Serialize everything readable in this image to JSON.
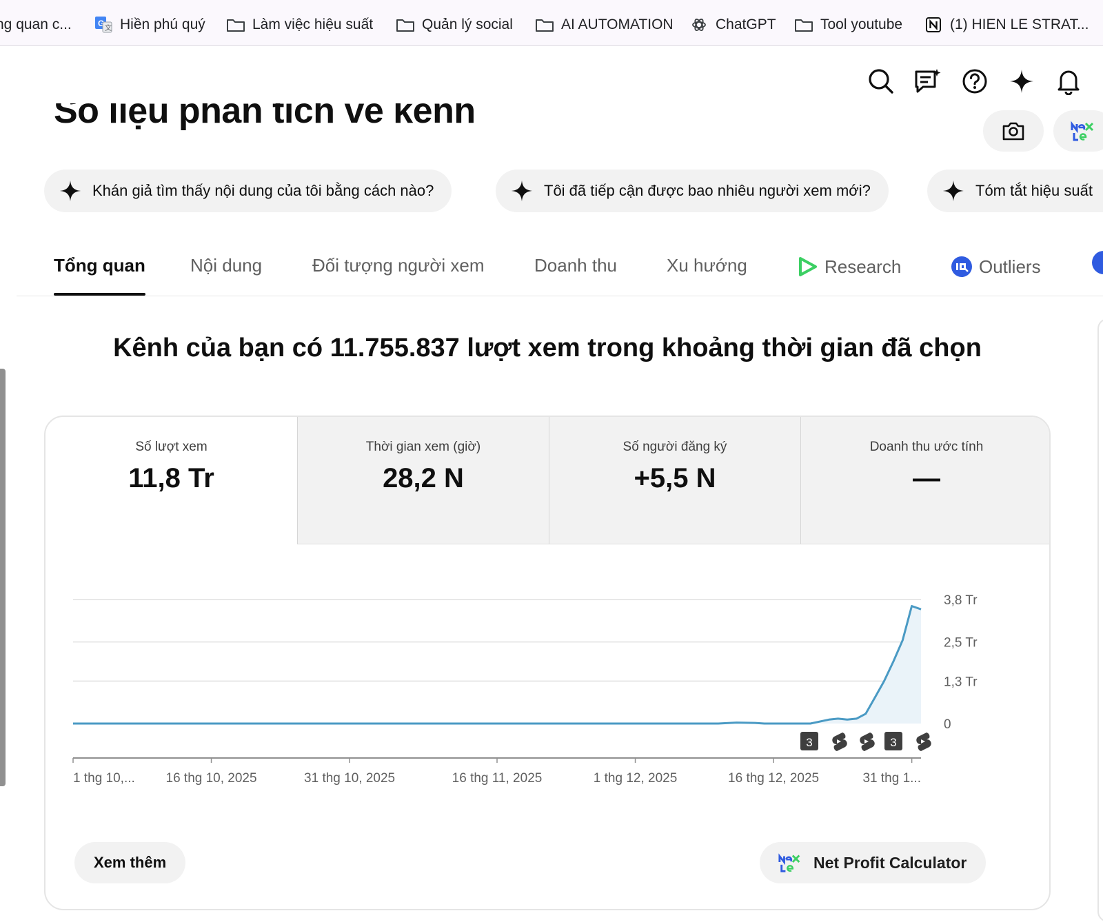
{
  "bookmarks": [
    {
      "label": "ng quan c...",
      "icon": "none"
    },
    {
      "label": "Hiền phú quý",
      "icon": "google-translate-icon"
    },
    {
      "label": "Làm việc hiệu suất",
      "icon": "folder-icon"
    },
    {
      "label": "Quản lý social",
      "icon": "folder-icon"
    },
    {
      "label": "AI AUTOMATION",
      "icon": "folder-icon"
    },
    {
      "label": "ChatGPT",
      "icon": "chatgpt-icon"
    },
    {
      "label": "Tool youtube",
      "icon": "folder-icon"
    },
    {
      "label": "(1) HIEN LE STRAT...",
      "icon": "notion-icon"
    }
  ],
  "page": {
    "title": "Số liệu phân tích về kênh",
    "headline": "Kênh của bạn có 11.755.837 lượt xem trong khoảng thời gian đã chọn"
  },
  "chips": [
    "Khán giả tìm thấy nội dung của tôi bằng cách nào?",
    "Tôi đã tiếp cận được bao nhiêu người xem mới?",
    "Tóm tắt hiệu suất"
  ],
  "tabs": [
    {
      "label": "Tổng quan",
      "active": true
    },
    {
      "label": "Nội dung"
    },
    {
      "label": "Đối tượng người xem"
    },
    {
      "label": "Doanh thu"
    },
    {
      "label": "Xu hướng"
    },
    {
      "label": "Research",
      "icon": "research-play-icon"
    },
    {
      "label": "Outliers",
      "icon": "outliers-icon"
    }
  ],
  "metrics": [
    {
      "label": "Số lượt xem",
      "value": "11,8 Tr",
      "active": true
    },
    {
      "label": "Thời gian xem (giờ)",
      "value": "28,2 N"
    },
    {
      "label": "Số người đăng ký",
      "value": "+5,5 N"
    },
    {
      "label": "Doanh thu ước tính",
      "value": "—"
    }
  ],
  "chart_data": {
    "type": "area",
    "x_tick_labels": [
      "1 thg 10,...",
      "16 thg 10, 2025",
      "31 thg 10, 2025",
      "16 thg 11, 2025",
      "1 thg 12, 2025",
      "16 thg 12, 2025",
      "31 thg 1..."
    ],
    "y_tick_labels": [
      "3,8 Tr",
      "2,5 Tr",
      "1,3 Tr",
      "0"
    ],
    "ylim": [
      0,
      3.8
    ],
    "unit": "Tr",
    "x_days": [
      0,
      10,
      20,
      30,
      40,
      50,
      60,
      70,
      72,
      74,
      75,
      76,
      78,
      80,
      82,
      83,
      84,
      85,
      86,
      87,
      88,
      89,
      90,
      91
    ],
    "values": [
      0,
      0,
      0,
      0,
      0,
      0,
      0,
      0,
      0.03,
      0.02,
      0,
      0,
      0,
      0,
      0.12,
      0.15,
      0.12,
      0.15,
      0.3,
      0.8,
      1.3,
      1.9,
      2.55,
      3.6
    ],
    "last_point": {
      "x": 92,
      "y": 3.5
    },
    "grid": true,
    "color": "#4a9ac4",
    "publish_markers": [
      {
        "kind": "count",
        "label": "3"
      },
      {
        "kind": "shorts-icon"
      },
      {
        "kind": "shorts-icon"
      },
      {
        "kind": "count",
        "label": "3"
      },
      {
        "kind": "shorts-icon"
      }
    ]
  },
  "buttons": {
    "more": "Xem thêm",
    "calc": "Net Profit Calculator"
  },
  "colors": {
    "accent_line": "#4a9ac4",
    "chip_bg": "#f2f2f2",
    "research_green": "#3ccf63",
    "outliers_blue": "#2f5be0"
  }
}
